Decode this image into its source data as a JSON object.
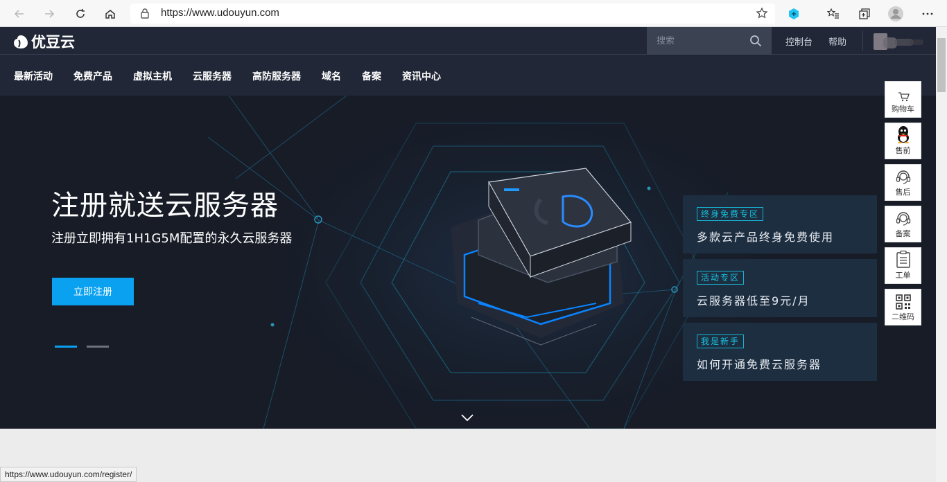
{
  "browser": {
    "url": "https://www.udouyun.com",
    "status_url": "https://www.udouyun.com/register/"
  },
  "header": {
    "logo_text": "优豆云",
    "search_placeholder": "搜索",
    "links": [
      "控制台",
      "帮助"
    ]
  },
  "nav": {
    "items": [
      "最新活动",
      "免费产品",
      "虚拟主机",
      "云服务器",
      "高防服务器",
      "域名",
      "备案",
      "资讯中心"
    ]
  },
  "hero": {
    "title": "注册就送云服务器",
    "subtitle": "注册立即拥有1H1G5M配置的永久云服务器",
    "button": "立即注册",
    "active_slide": 1,
    "slide_count": 2
  },
  "promos": [
    {
      "tag": "终身免费专区",
      "text": "多款云产品终身免费使用"
    },
    {
      "tag": "活动专区",
      "text": "云服务器低至9元/月"
    },
    {
      "tag": "我是新手",
      "text": "如何开通免费云服务器"
    }
  ],
  "side_bar": [
    "购物车",
    "售前",
    "售后",
    "备案",
    "工单",
    "二维码"
  ],
  "colors": {
    "header_bg": "#212736",
    "hero_bg": "#171c27",
    "accent": "#0aa1f0",
    "tag_cyan": "#16c3e0"
  }
}
